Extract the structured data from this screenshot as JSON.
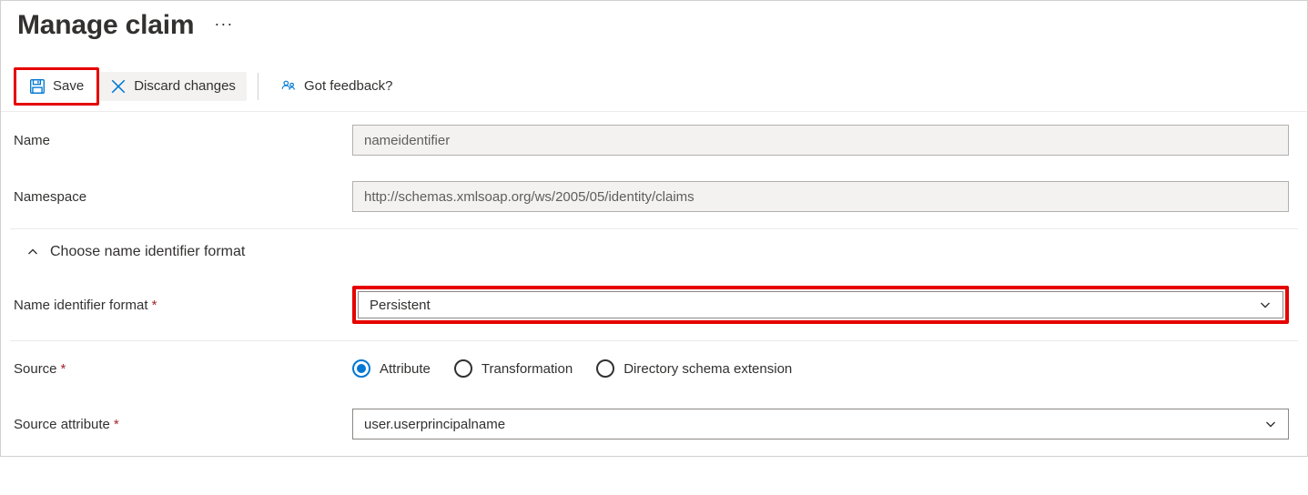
{
  "header": {
    "title": "Manage claim"
  },
  "toolbar": {
    "save_label": "Save",
    "discard_label": "Discard changes",
    "feedback_label": "Got feedback?"
  },
  "form": {
    "name_label": "Name",
    "name_value": "nameidentifier",
    "namespace_label": "Namespace",
    "namespace_value": "http://schemas.xmlsoap.org/ws/2005/05/identity/claims",
    "collapse_label": "Choose name identifier format",
    "nif_label": "Name identifier format",
    "nif_value": "Persistent",
    "source_label": "Source",
    "source_options": {
      "attribute": "Attribute",
      "transformation": "Transformation",
      "directory": "Directory schema extension"
    },
    "source_attr_label": "Source attribute",
    "source_attr_value": "user.userprincipalname"
  }
}
